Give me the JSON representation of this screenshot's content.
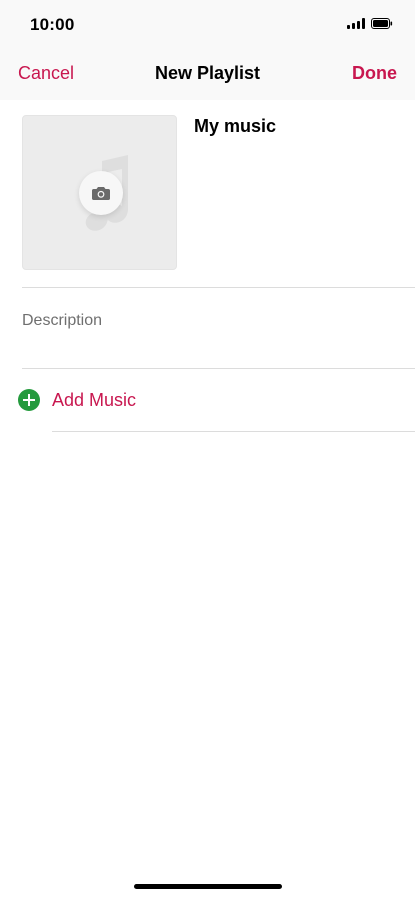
{
  "status_bar": {
    "time": "10:00",
    "icons": [
      "signal-icon",
      "battery-icon"
    ]
  },
  "nav": {
    "cancel_label": "Cancel",
    "title": "New Playlist",
    "done_label": "Done"
  },
  "playlist": {
    "artwork_icons": [
      "music-note-icon",
      "camera-icon"
    ],
    "name": "My music",
    "description_placeholder": "Description"
  },
  "actions": {
    "add_music_label": "Add Music",
    "add_music_icon": "plus-circle-icon"
  },
  "colors": {
    "accent": "#c8174f",
    "add_green": "#249a3d",
    "placeholder": "#6f6f6f"
  }
}
